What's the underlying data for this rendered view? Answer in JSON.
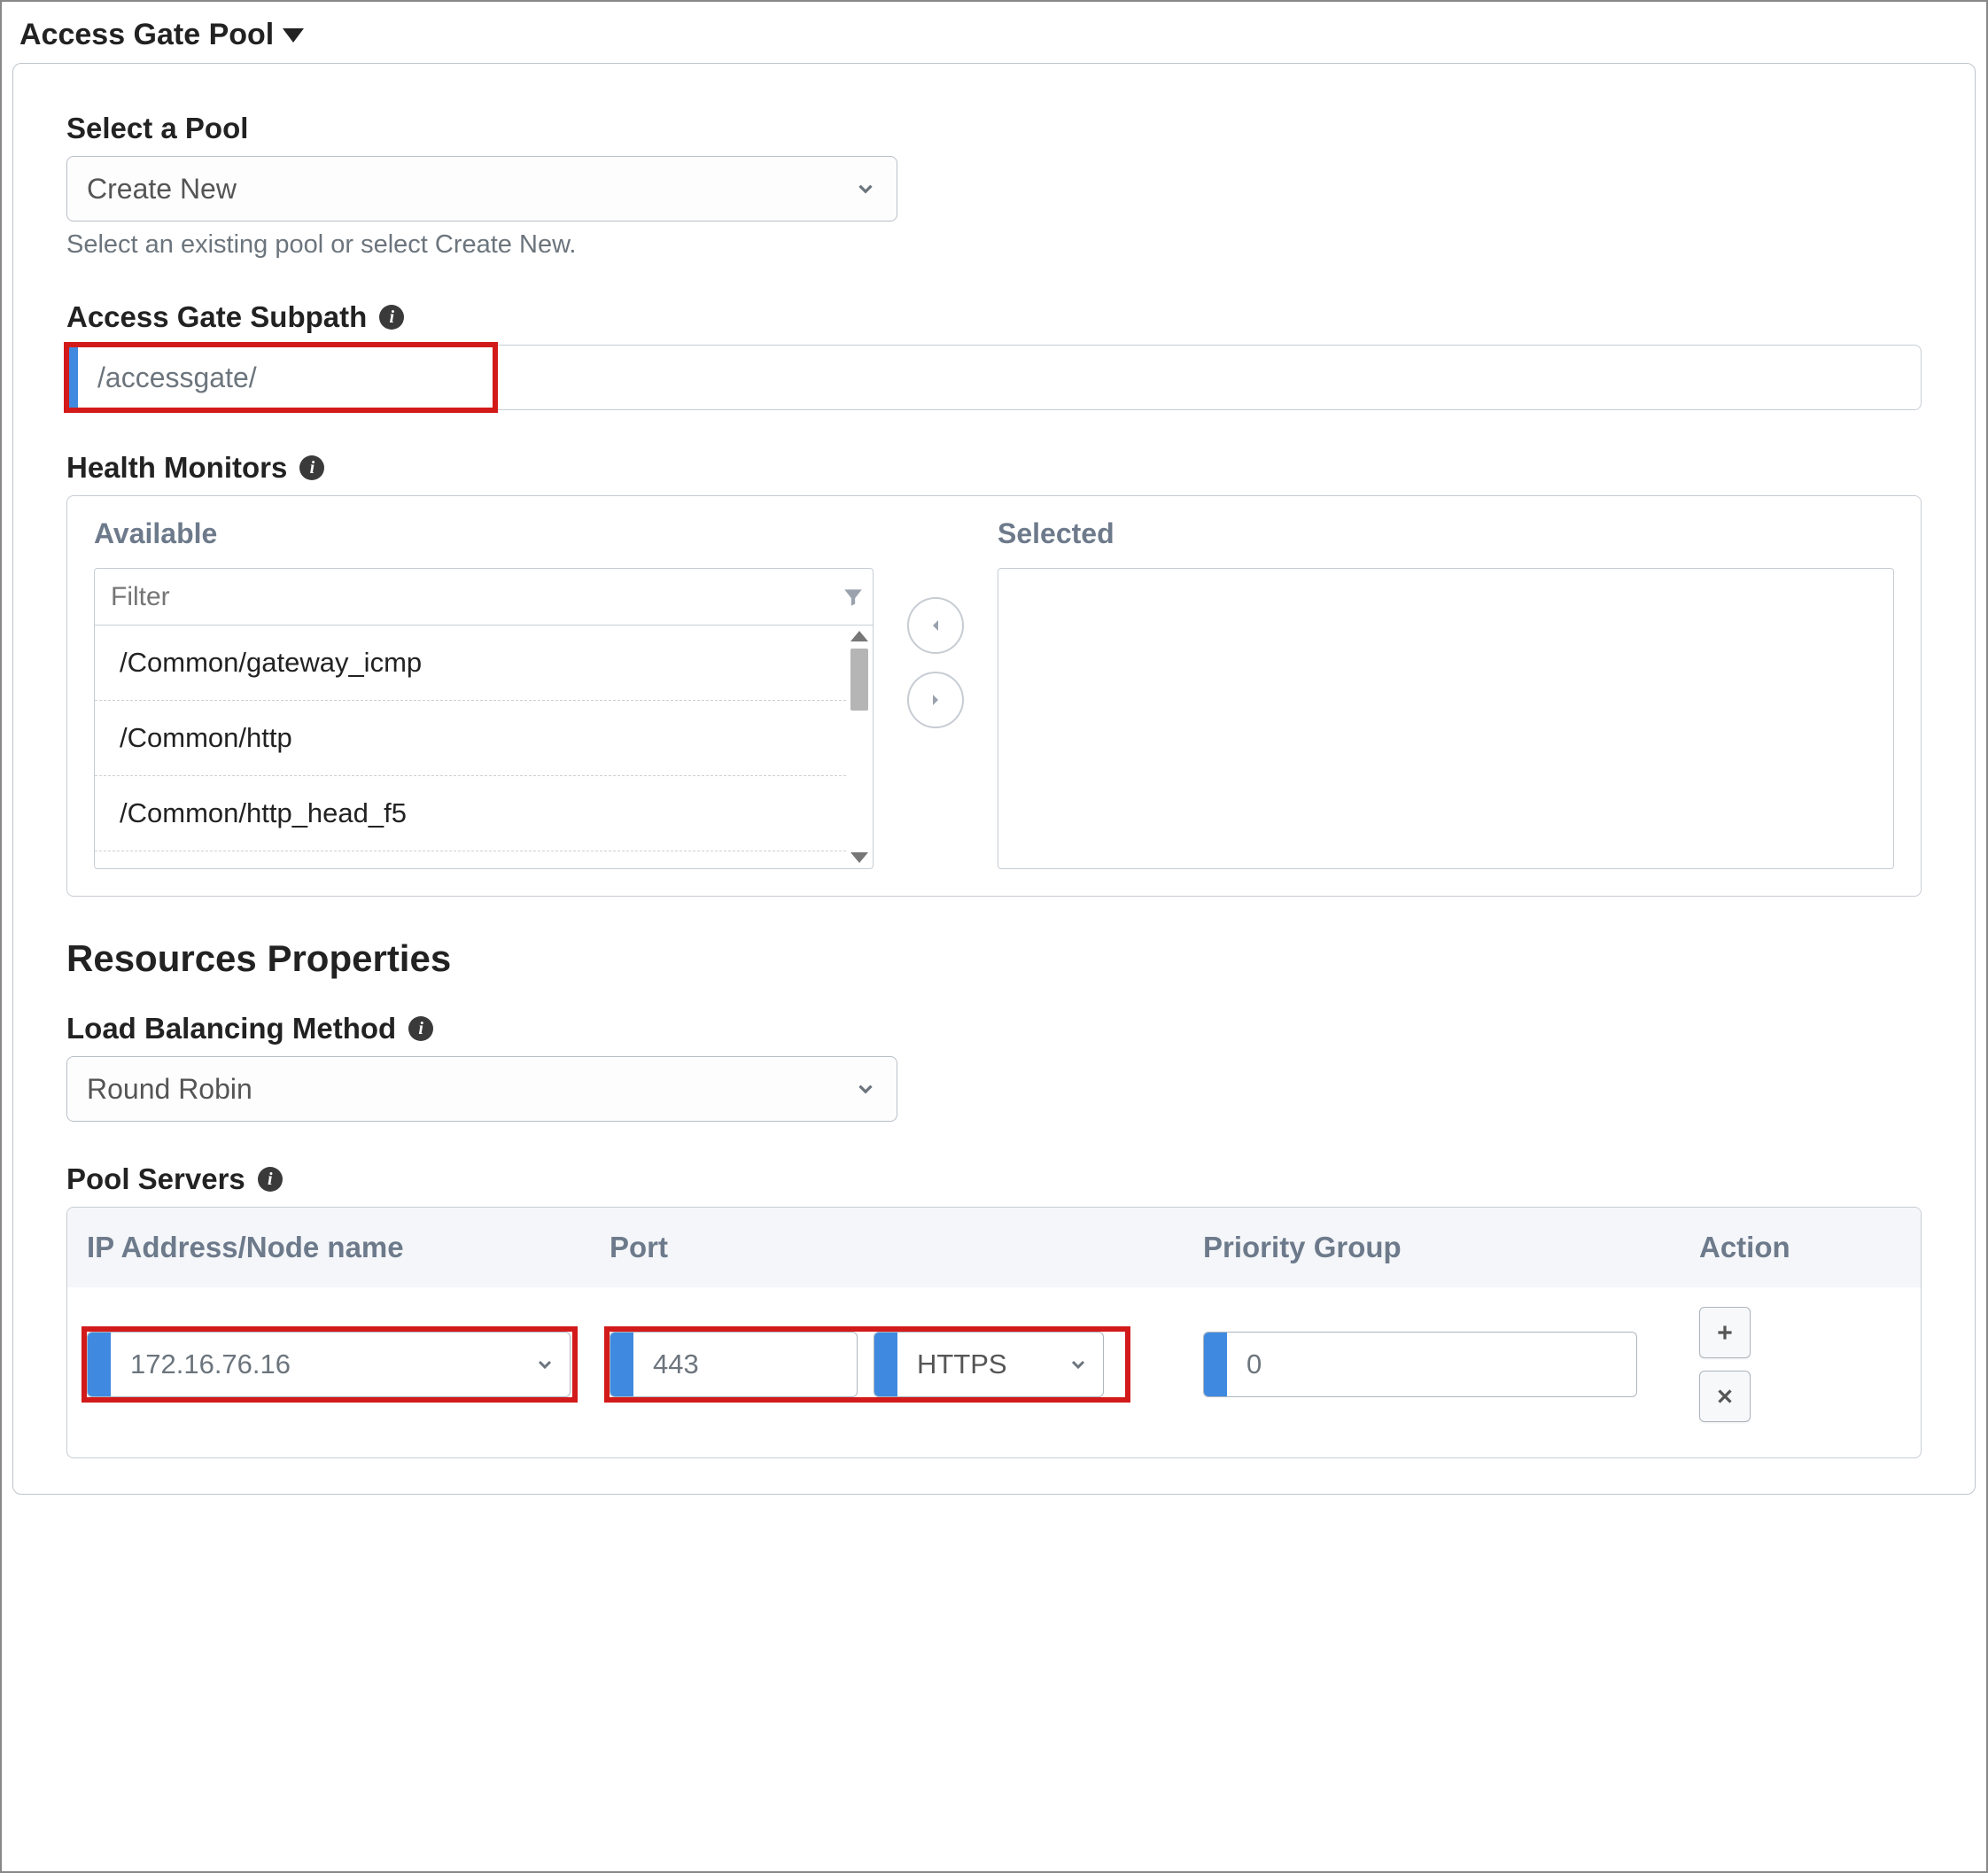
{
  "section_title": "Access Gate Pool",
  "select_pool": {
    "label": "Select a Pool",
    "value": "Create New",
    "helper": "Select an existing pool or select Create New."
  },
  "subpath": {
    "label": "Access Gate Subpath",
    "value": "/accessgate/"
  },
  "health_monitors": {
    "label": "Health Monitors",
    "available_label": "Available",
    "selected_label": "Selected",
    "filter_placeholder": "Filter",
    "items": [
      "/Common/gateway_icmp",
      "/Common/http",
      "/Common/http_head_f5"
    ]
  },
  "resources_heading": "Resources Properties",
  "lb_method": {
    "label": "Load Balancing Method",
    "value": "Round Robin"
  },
  "pool_servers": {
    "label": "Pool Servers",
    "columns": {
      "ip": "IP Address/Node name",
      "port": "Port",
      "priority": "Priority Group",
      "action": "Action"
    },
    "row": {
      "ip": "172.16.76.16",
      "port": "443",
      "protocol": "HTTPS",
      "priority": "0"
    }
  }
}
